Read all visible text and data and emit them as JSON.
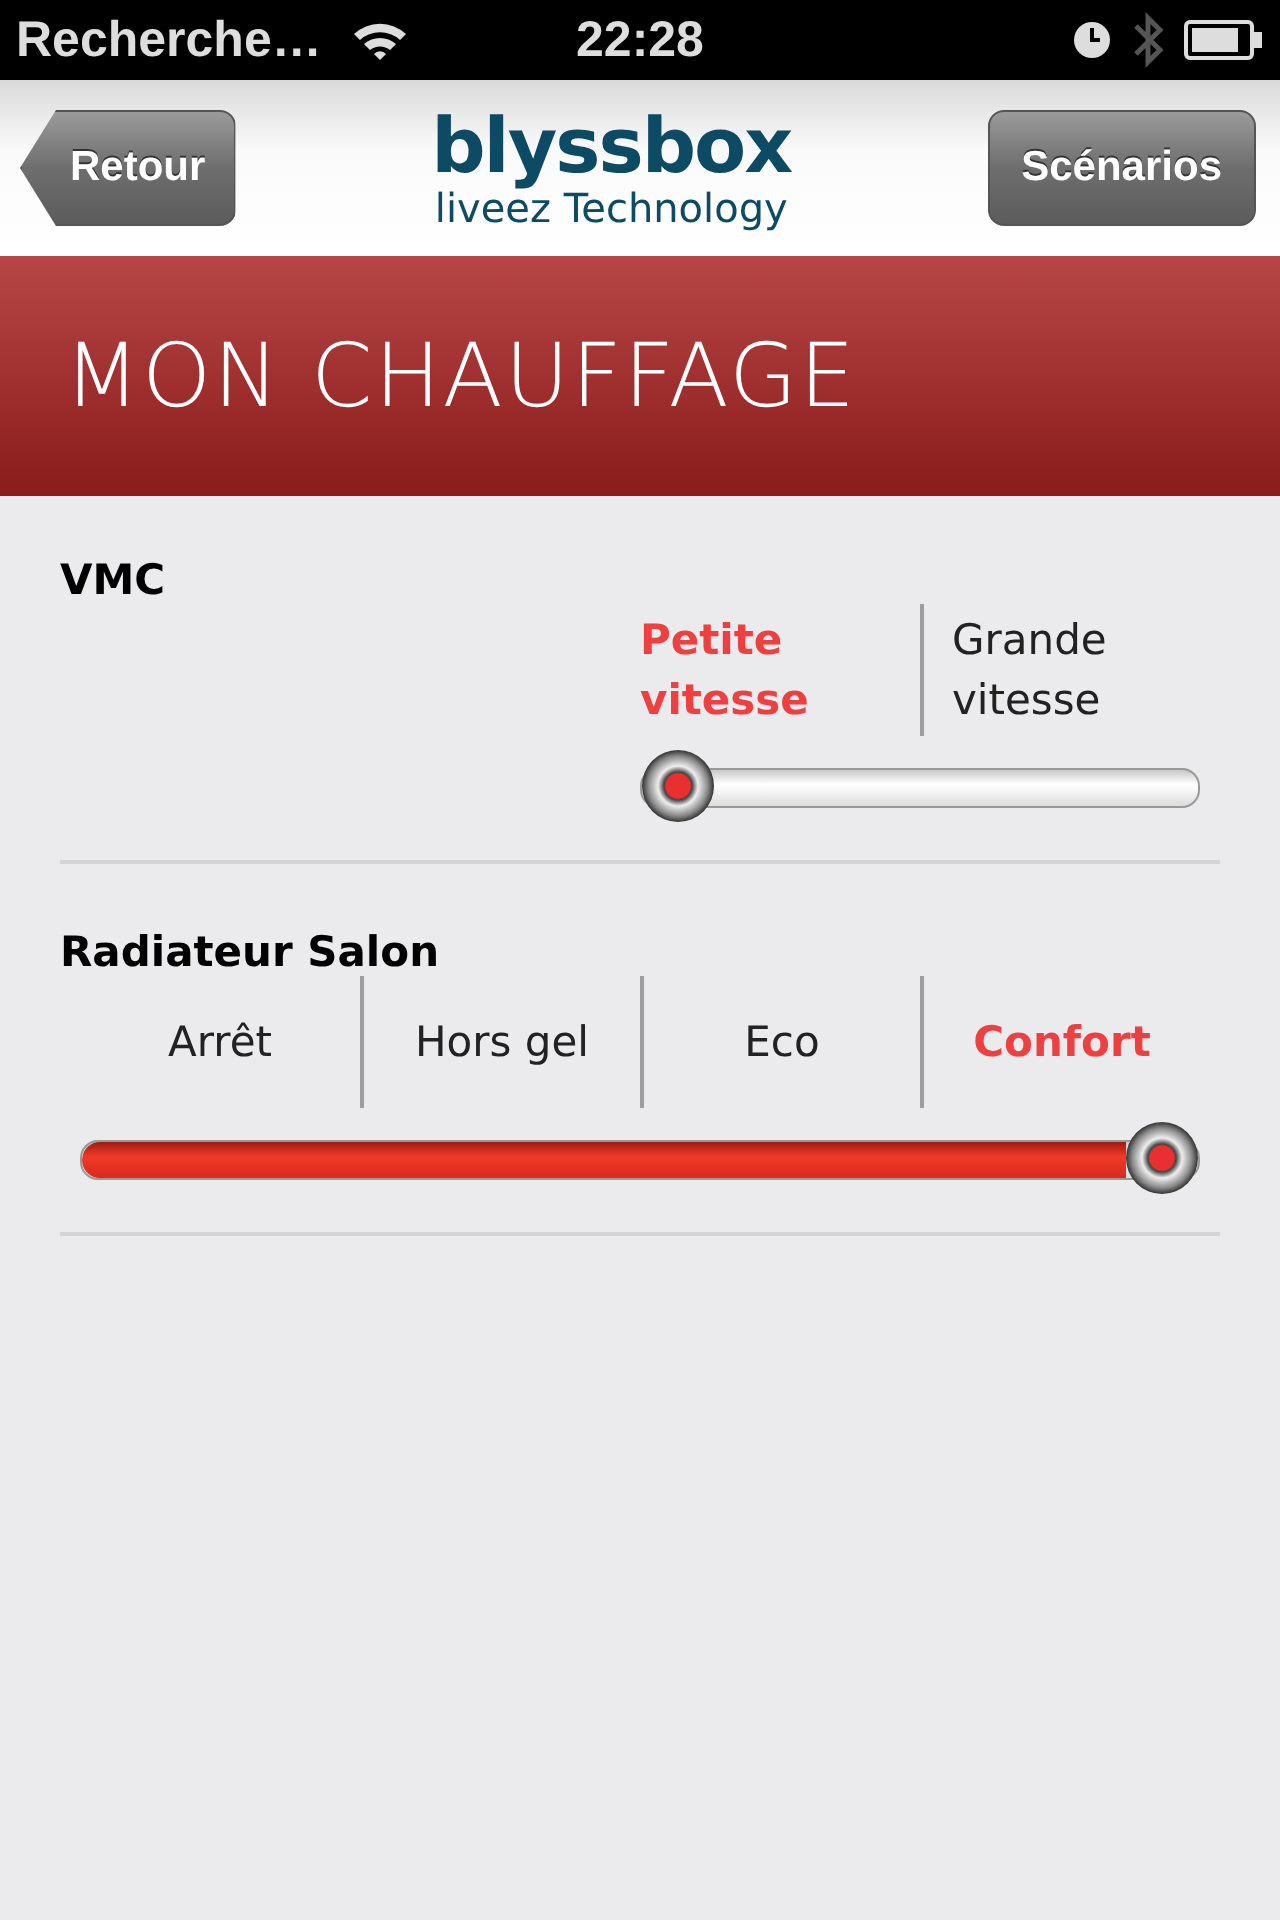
{
  "status_bar": {
    "carrier": "Recherche…",
    "time": "22:28"
  },
  "nav": {
    "back": "Retour",
    "logo": "blyssbox",
    "tagline": "liveez Technology",
    "action": "Scénarios"
  },
  "header": {
    "title": "MON CHAUFFAGE"
  },
  "devices": [
    {
      "name": "VMC",
      "level": 0,
      "options": [
        {
          "label": "Petite vitesse",
          "selected": true
        },
        {
          "label": "Grande vitesse",
          "selected": false
        }
      ]
    },
    {
      "name": "Radiateur Salon",
      "level": 1,
      "options": [
        {
          "label": "Arrêt",
          "selected": false
        },
        {
          "label": "Hors gel",
          "selected": false
        },
        {
          "label": "Eco",
          "selected": false
        },
        {
          "label": "Confort",
          "selected": true
        }
      ]
    }
  ]
}
